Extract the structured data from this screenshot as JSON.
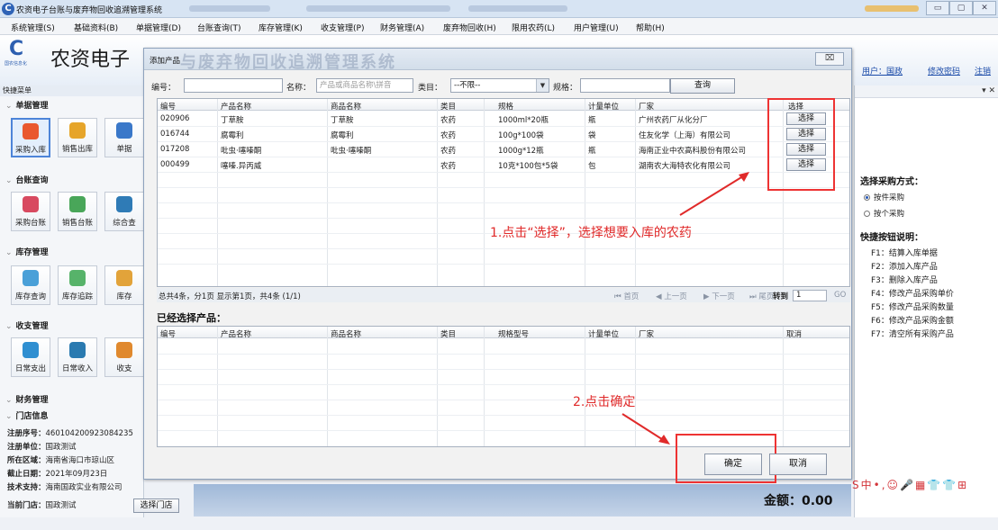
{
  "window": {
    "title": "农资电子台账与废弃物回收追溯管理系统"
  },
  "menu": [
    "系统管理(S)",
    "基础资料(B)",
    "单据管理(D)",
    "台账查询(T)",
    "库存管理(K)",
    "收支管理(P)",
    "财务管理(A)",
    "废弃物回收(H)",
    "限用农药(L)",
    "用户管理(U)",
    "帮助(H)"
  ],
  "header": {
    "logo_sub": "国农信息化",
    "brand": "农资电子",
    "user": "用户：国政",
    "change_pwd": "修改密码",
    "logout": "注销"
  },
  "sidebar": {
    "title": "快捷菜单",
    "sections": {
      "bill": "单据管理",
      "ledger": "台账查询",
      "stock": "库存管理",
      "cash": "收支管理",
      "finance": "财务管理",
      "store": "门店信息"
    },
    "bill_tiles": [
      "采购入库",
      "销售出库",
      "单据"
    ],
    "ledger_tiles": [
      "采购台账",
      "销售台账",
      "综合查"
    ],
    "stock_tiles": [
      "库存查询",
      "库存追踪",
      "库存"
    ],
    "cash_tiles": [
      "日常支出",
      "日常收入",
      "收支"
    ],
    "info": {
      "reg_no_label": "注册序号：",
      "reg_no": "460104200923084235",
      "unit_label": "注册单位：",
      "unit": "国政测试",
      "area_label": "所在区域：",
      "area": "海南省海口市琼山区",
      "expire_label": "截止日期：",
      "expire": "2021年09月23日",
      "support_label": "技术支持：",
      "support": "海南国政实业有限公司",
      "store_label": "当前门店：",
      "store": "国政测试",
      "store_btn": "选择门店"
    }
  },
  "right_panel": {
    "close_text": "▾ ✕",
    "purchase_mode_title": "选择采购方式：",
    "mode_by_piece": "按件采购",
    "mode_by_item": "按个采购",
    "shortcut_title": "快捷按钮说明：",
    "shortcuts": [
      "F1：结算入库单据",
      "F2：添加入库产品",
      "F3：删除入库产品",
      "F4：修改产品采购单价",
      "F5：修改产品采购数量",
      "F6：修改产品采购金额",
      "F7：清空所有采购产品"
    ]
  },
  "dialog": {
    "title": "添加产品",
    "watermark": "与废弃物回收追溯管理系统",
    "close_label": "⌧",
    "filters": {
      "code_label": "编号：",
      "name_label": "名称：",
      "name_placeholder": "产品或商品名称\\拼音",
      "category_label": "类目：",
      "category_value": "--不限--",
      "spec_label": "规格：",
      "query_btn": "查询"
    },
    "columns": [
      "编号",
      "产品名称",
      "商品名称",
      "类目",
      "规格",
      "计量单位",
      "厂家",
      "选择"
    ],
    "rows": [
      {
        "code": "020906",
        "product": "丁草胺",
        "goods": "丁草胺",
        "category": "农药",
        "spec": "1000ml*20瓶",
        "unit": "瓶",
        "maker": "广州农药厂从化分厂",
        "action": "选择"
      },
      {
        "code": "016744",
        "product": "腐霉利",
        "goods": "腐霉利",
        "category": "农药",
        "spec": "100g*100袋",
        "unit": "袋",
        "maker": "住友化学（上海）有限公司",
        "action": "选择"
      },
      {
        "code": "017208",
        "product": "吡虫·噻嗪酮",
        "goods": "吡虫·噻嗪酮",
        "category": "农药",
        "spec": "1000g*12瓶",
        "unit": "瓶",
        "maker": "海南正业中农高科股份有限公司",
        "action": "选择"
      },
      {
        "code": "000499",
        "product": "噻嗪.异丙威",
        "goods": "",
        "category": "农药",
        "spec": "10克*100包*5袋",
        "unit": "包",
        "maker": "湖南农大海特农化有限公司",
        "action": "选择"
      }
    ],
    "pager": {
      "summary": "总共4条，分1页 显示第1页，共4条 (1/1)",
      "first": "⏮ 首页",
      "prev": "◀ 上一页",
      "next": "▶ 下一页",
      "last": "⏭ 尾页",
      "goto_label": "转到",
      "page_value": "1",
      "go": "GO"
    },
    "selected_title": "已经选择产品：",
    "selected_columns": [
      "编号",
      "产品名称",
      "商品名称",
      "类目",
      "规格型号",
      "计量单位",
      "厂家",
      "取消"
    ],
    "annotation1": "1.点击“选择”，选择想要入库的农药",
    "annotation2": "2.点击确定",
    "ok_btn": "确定",
    "cancel_btn": "取消"
  },
  "footer": {
    "amount": "金额：0.00"
  },
  "tray": {
    "text": "S中•,☺🎤▦👕👕⊞"
  }
}
